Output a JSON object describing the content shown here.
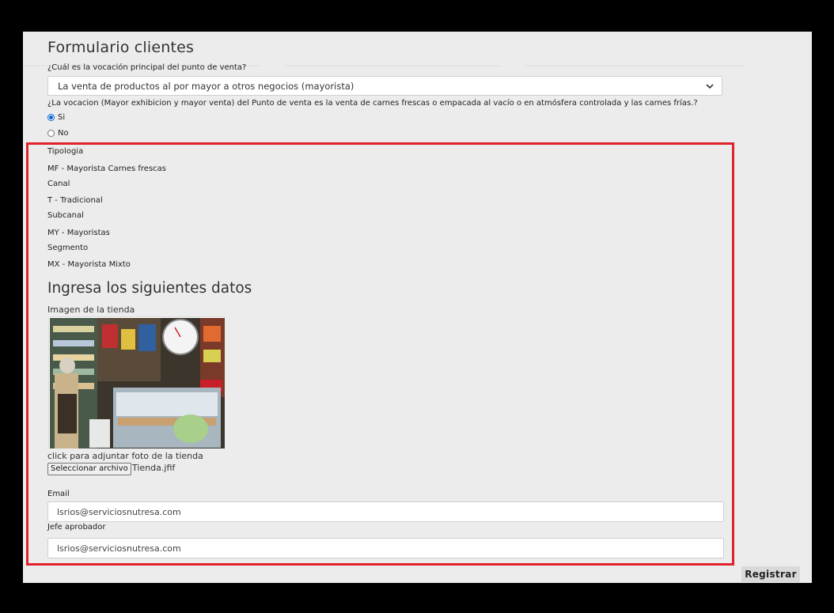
{
  "form": {
    "title": "Formulario clientes",
    "q1_label": "¿Cuál es la vocación principal del punto de venta?",
    "q1_value": "La venta de productos al por mayor a otros negocios (mayorista)",
    "q2_label": "¿La vocacion (Mayor exhibicion y mayor venta) del Punto de venta es la venta de carnes frescas o empacada al vacío o en atmósfera controlada y las carnes frías.?",
    "q2_options": [
      {
        "label": "Si",
        "selected": true
      },
      {
        "label": "No",
        "selected": false
      }
    ]
  },
  "classification": {
    "tipologia_label": "Tipologia",
    "tipologia_value": "MF - Mayorista Carnes frescas",
    "canal_label": "Canal",
    "canal_value": "T - Tradicional",
    "subcanal_label": "Subcanal",
    "subcanal_value": "MY - Mayoristas",
    "segmento_label": "Segmento",
    "segmento_value": "MX - Mayorista Mixto"
  },
  "datos": {
    "heading": "Ingresa los siguientes datos",
    "image_label": "Imagen de la tienda",
    "attach_hint": "click para adjuntar foto de la tienda",
    "file_button": "Seleccionar archivo",
    "file_name": "Tienda.jfif",
    "email_label": "Email",
    "email_value": "lsrios@serviciosnutresa.com",
    "jefe_label": "Jefe aprobador",
    "jefe_value": "lsrios@serviciosnutresa.com"
  },
  "actions": {
    "submit": "Registrar"
  },
  "colors": {
    "highlight": "#e0222c",
    "radio_selected": "#0a64d6"
  }
}
